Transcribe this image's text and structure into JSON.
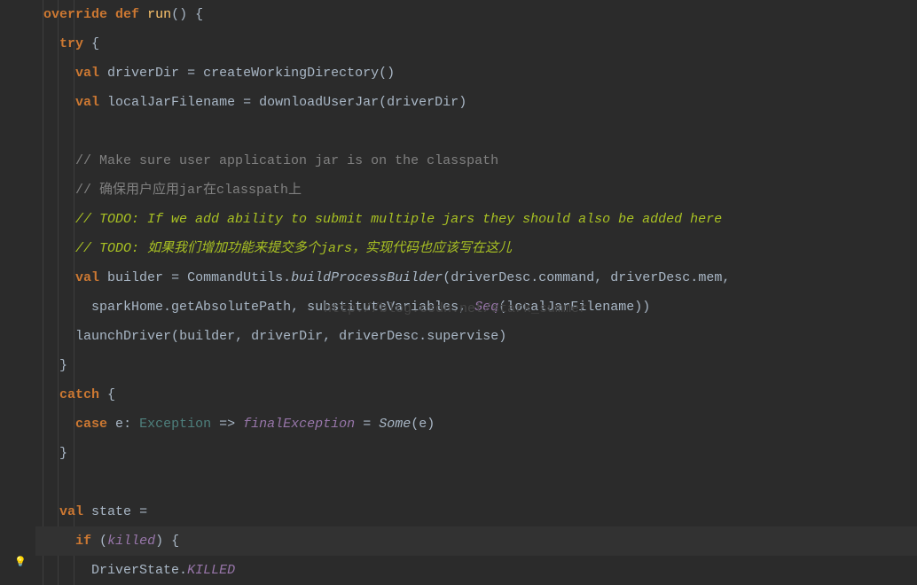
{
  "watermark": "http://blog.csdn.net/stark_summer",
  "tokens": {
    "kw_override": "override",
    "kw_def": "def",
    "kw_try": "try",
    "kw_val": "val",
    "kw_catch": "catch",
    "kw_case": "case",
    "kw_if": "if",
    "fn_run": "run",
    "lparen": "(",
    "rparen": ")",
    "lbrace": "{",
    "rbrace": "}",
    "space": " ",
    "colon": ":",
    "comma": ",",
    "arrow": "=>",
    "eq": "=",
    "dot": ".",
    "id_driverDir": "driverDir",
    "id_createWorkingDirectory": "createWorkingDirectory",
    "id_localJarFilename": "localJarFilename",
    "id_downloadUserJar": "downloadUserJar",
    "id_builder": "builder",
    "id_CommandUtils": "CommandUtils",
    "id_buildProcessBuilder": "buildProcessBuilder",
    "id_driverDesc": "driverDesc",
    "id_command": "command",
    "id_mem": "mem",
    "id_sparkHome": "sparkHome",
    "id_getAbsolutePath": "getAbsolutePath",
    "id_substituteVariables": "substituteVariables",
    "id_Seq": "Seq",
    "id_launchDriver": "launchDriver",
    "id_supervise": "supervise",
    "id_e": "e",
    "id_Exception": "Exception",
    "id_finalException": "finalException",
    "id_Some": "Some",
    "id_state": "state",
    "id_killed": "killed",
    "id_DriverState": "DriverState",
    "id_KILLED": "KILLED",
    "comment1": "// Make sure user application jar is on the classpath",
    "comment2": "// 确保用户应用jar在classpath上",
    "todo1": "// TODO: If we add ability to submit multiple jars they should also be added here",
    "todo2": "// TODO: 如果我们增加功能来提交多个jars，实现代码也应该写在这儿"
  }
}
